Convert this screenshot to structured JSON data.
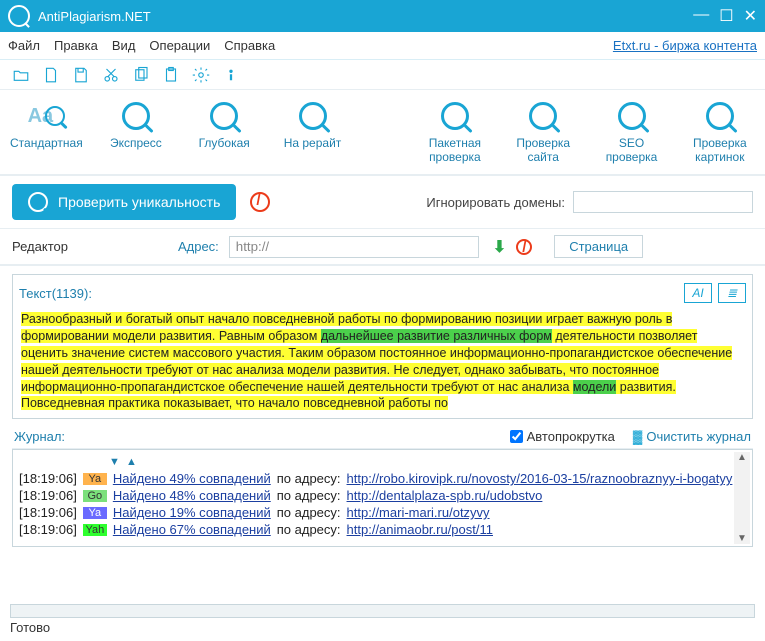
{
  "title": "AntiPlagiarism.NET",
  "topLink": "Etxt.ru - биржа контента",
  "menu": [
    "Файл",
    "Правка",
    "Вид",
    "Операции",
    "Справка"
  ],
  "bigButtons": {
    "std": "Стандартная",
    "express": "Экспресс",
    "deep": "Глубокая",
    "rewrite": "На рерайт",
    "batch1": "Пакетная",
    "batch2": "проверка",
    "site1": "Проверка",
    "site2": "сайта",
    "seo1": "SEO",
    "seo2": "проверка",
    "img1": "Проверка",
    "img2": "картинок"
  },
  "checkBtn": "Проверить уникальность",
  "ignoreLabel": "Игнорировать домены:",
  "editorLabel": "Редактор",
  "addressLabel": "Адрес:",
  "addressValue": "http://",
  "pageTab": "Страница",
  "textLabel": "Текст(1139):",
  "text": {
    "p1a": "Разнообразный и богатый опыт начало повседневной работы по формированию позиции играет важную роль в формировании модели развития. Равным образом ",
    "p1g": "дальнейшее развитие различных форм",
    "p1b": " деятельности позволяет оценить значение систем массового участия. Таким образом постоянное информационно-пропагандистское обеспечение нашей деятельности требуют от нас анализа модели развития. Не следует, однако забывать, что постоянное информационно-пропагандистское обеспечение нашей деятельности требуют от нас анализа ",
    "p1g2": "модели",
    "p1c": " развития. Повседневная практика показывает, что начало повседневной работы по"
  },
  "journalLabel": "Журнал:",
  "autoScroll": "Автопрокрутка",
  "clearJournal": "Очистить журнал",
  "log": [
    {
      "ts": "[18:19:06]",
      "badge": "Ya",
      "cls": "b-ya",
      "found": "Найдено 49% совпадений",
      "at": " по адресу: ",
      "url": "http://robo.kirovipk.ru/novosty/2016-03-15/raznoobraznyy-i-bogatyy"
    },
    {
      "ts": "[18:19:06]",
      "badge": "Go",
      "cls": "b-go",
      "found": "Найдено 48% совпадений",
      "at": " по адресу: ",
      "url": "http://dentalplaza-spb.ru/udobstvo"
    },
    {
      "ts": "[18:19:06]",
      "badge": "Ya",
      "cls": "b-yab",
      "found": "Найдено 19% совпадений",
      "at": " по адресу: ",
      "url": "http://mari-mari.ru/otzyvy"
    },
    {
      "ts": "[18:19:06]",
      "badge": "Yah",
      "cls": "b-yah",
      "found": "Найдено 67% совпадений",
      "at": " по адресу: ",
      "url": "http://animaobr.ru/post/11"
    }
  ],
  "statusText": "Готово"
}
